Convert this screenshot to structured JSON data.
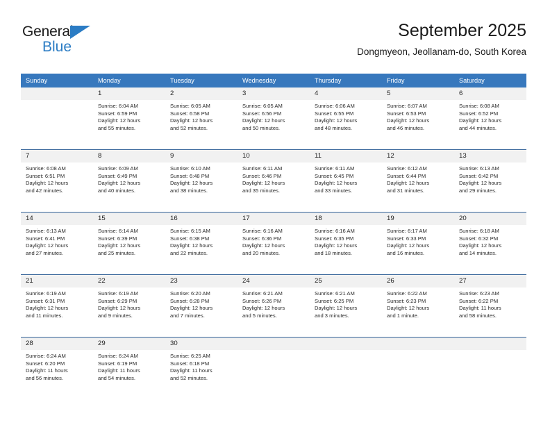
{
  "brand": {
    "name_part1": "General",
    "name_part2": "Blue",
    "triangle_icon": "triangle-icon",
    "accent_color": "#2b7cc4"
  },
  "header": {
    "title": "September 2025",
    "subtitle": "Dongmyeon, Jeollanam-do, South Korea"
  },
  "calendar": {
    "header_color": "#3778bd",
    "daynum_band_color": "#f1f1f1",
    "week_divider_color": "#2f5f96",
    "weekday_headers": [
      "Sunday",
      "Monday",
      "Tuesday",
      "Wednesday",
      "Thursday",
      "Friday",
      "Saturday"
    ],
    "weeks": [
      [
        {
          "day": "",
          "empty": true,
          "sunrise": "",
          "sunset": "",
          "daylight1": "",
          "daylight2": ""
        },
        {
          "day": "1",
          "sunrise": "Sunrise: 6:04 AM",
          "sunset": "Sunset: 6:59 PM",
          "daylight1": "Daylight: 12 hours",
          "daylight2": "and 55 minutes."
        },
        {
          "day": "2",
          "sunrise": "Sunrise: 6:05 AM",
          "sunset": "Sunset: 6:58 PM",
          "daylight1": "Daylight: 12 hours",
          "daylight2": "and 52 minutes."
        },
        {
          "day": "3",
          "sunrise": "Sunrise: 6:05 AM",
          "sunset": "Sunset: 6:56 PM",
          "daylight1": "Daylight: 12 hours",
          "daylight2": "and 50 minutes."
        },
        {
          "day": "4",
          "sunrise": "Sunrise: 6:06 AM",
          "sunset": "Sunset: 6:55 PM",
          "daylight1": "Daylight: 12 hours",
          "daylight2": "and 48 minutes."
        },
        {
          "day": "5",
          "sunrise": "Sunrise: 6:07 AM",
          "sunset": "Sunset: 6:53 PM",
          "daylight1": "Daylight: 12 hours",
          "daylight2": "and 46 minutes."
        },
        {
          "day": "6",
          "sunrise": "Sunrise: 6:08 AM",
          "sunset": "Sunset: 6:52 PM",
          "daylight1": "Daylight: 12 hours",
          "daylight2": "and 44 minutes."
        }
      ],
      [
        {
          "day": "7",
          "sunrise": "Sunrise: 6:08 AM",
          "sunset": "Sunset: 6:51 PM",
          "daylight1": "Daylight: 12 hours",
          "daylight2": "and 42 minutes."
        },
        {
          "day": "8",
          "sunrise": "Sunrise: 6:09 AM",
          "sunset": "Sunset: 6:49 PM",
          "daylight1": "Daylight: 12 hours",
          "daylight2": "and 40 minutes."
        },
        {
          "day": "9",
          "sunrise": "Sunrise: 6:10 AM",
          "sunset": "Sunset: 6:48 PM",
          "daylight1": "Daylight: 12 hours",
          "daylight2": "and 38 minutes."
        },
        {
          "day": "10",
          "sunrise": "Sunrise: 6:11 AM",
          "sunset": "Sunset: 6:46 PM",
          "daylight1": "Daylight: 12 hours",
          "daylight2": "and 35 minutes."
        },
        {
          "day": "11",
          "sunrise": "Sunrise: 6:11 AM",
          "sunset": "Sunset: 6:45 PM",
          "daylight1": "Daylight: 12 hours",
          "daylight2": "and 33 minutes."
        },
        {
          "day": "12",
          "sunrise": "Sunrise: 6:12 AM",
          "sunset": "Sunset: 6:44 PM",
          "daylight1": "Daylight: 12 hours",
          "daylight2": "and 31 minutes."
        },
        {
          "day": "13",
          "sunrise": "Sunrise: 6:13 AM",
          "sunset": "Sunset: 6:42 PM",
          "daylight1": "Daylight: 12 hours",
          "daylight2": "and 29 minutes."
        }
      ],
      [
        {
          "day": "14",
          "sunrise": "Sunrise: 6:13 AM",
          "sunset": "Sunset: 6:41 PM",
          "daylight1": "Daylight: 12 hours",
          "daylight2": "and 27 minutes."
        },
        {
          "day": "15",
          "sunrise": "Sunrise: 6:14 AM",
          "sunset": "Sunset: 6:39 PM",
          "daylight1": "Daylight: 12 hours",
          "daylight2": "and 25 minutes."
        },
        {
          "day": "16",
          "sunrise": "Sunrise: 6:15 AM",
          "sunset": "Sunset: 6:38 PM",
          "daylight1": "Daylight: 12 hours",
          "daylight2": "and 22 minutes."
        },
        {
          "day": "17",
          "sunrise": "Sunrise: 6:16 AM",
          "sunset": "Sunset: 6:36 PM",
          "daylight1": "Daylight: 12 hours",
          "daylight2": "and 20 minutes."
        },
        {
          "day": "18",
          "sunrise": "Sunrise: 6:16 AM",
          "sunset": "Sunset: 6:35 PM",
          "daylight1": "Daylight: 12 hours",
          "daylight2": "and 18 minutes."
        },
        {
          "day": "19",
          "sunrise": "Sunrise: 6:17 AM",
          "sunset": "Sunset: 6:33 PM",
          "daylight1": "Daylight: 12 hours",
          "daylight2": "and 16 minutes."
        },
        {
          "day": "20",
          "sunrise": "Sunrise: 6:18 AM",
          "sunset": "Sunset: 6:32 PM",
          "daylight1": "Daylight: 12 hours",
          "daylight2": "and 14 minutes."
        }
      ],
      [
        {
          "day": "21",
          "sunrise": "Sunrise: 6:19 AM",
          "sunset": "Sunset: 6:31 PM",
          "daylight1": "Daylight: 12 hours",
          "daylight2": "and 11 minutes."
        },
        {
          "day": "22",
          "sunrise": "Sunrise: 6:19 AM",
          "sunset": "Sunset: 6:29 PM",
          "daylight1": "Daylight: 12 hours",
          "daylight2": "and 9 minutes."
        },
        {
          "day": "23",
          "sunrise": "Sunrise: 6:20 AM",
          "sunset": "Sunset: 6:28 PM",
          "daylight1": "Daylight: 12 hours",
          "daylight2": "and 7 minutes."
        },
        {
          "day": "24",
          "sunrise": "Sunrise: 6:21 AM",
          "sunset": "Sunset: 6:26 PM",
          "daylight1": "Daylight: 12 hours",
          "daylight2": "and 5 minutes."
        },
        {
          "day": "25",
          "sunrise": "Sunrise: 6:21 AM",
          "sunset": "Sunset: 6:25 PM",
          "daylight1": "Daylight: 12 hours",
          "daylight2": "and 3 minutes."
        },
        {
          "day": "26",
          "sunrise": "Sunrise: 6:22 AM",
          "sunset": "Sunset: 6:23 PM",
          "daylight1": "Daylight: 12 hours",
          "daylight2": "and 1 minute."
        },
        {
          "day": "27",
          "sunrise": "Sunrise: 6:23 AM",
          "sunset": "Sunset: 6:22 PM",
          "daylight1": "Daylight: 11 hours",
          "daylight2": "and 58 minutes."
        }
      ],
      [
        {
          "day": "28",
          "sunrise": "Sunrise: 6:24 AM",
          "sunset": "Sunset: 6:20 PM",
          "daylight1": "Daylight: 11 hours",
          "daylight2": "and 56 minutes."
        },
        {
          "day": "29",
          "sunrise": "Sunrise: 6:24 AM",
          "sunset": "Sunset: 6:19 PM",
          "daylight1": "Daylight: 11 hours",
          "daylight2": "and 54 minutes."
        },
        {
          "day": "30",
          "sunrise": "Sunrise: 6:25 AM",
          "sunset": "Sunset: 6:18 PM",
          "daylight1": "Daylight: 11 hours",
          "daylight2": "and 52 minutes."
        },
        {
          "day": "",
          "empty": true,
          "sunrise": "",
          "sunset": "",
          "daylight1": "",
          "daylight2": ""
        },
        {
          "day": "",
          "empty": true,
          "sunrise": "",
          "sunset": "",
          "daylight1": "",
          "daylight2": ""
        },
        {
          "day": "",
          "empty": true,
          "sunrise": "",
          "sunset": "",
          "daylight1": "",
          "daylight2": ""
        },
        {
          "day": "",
          "empty": true,
          "sunrise": "",
          "sunset": "",
          "daylight1": "",
          "daylight2": ""
        }
      ]
    ]
  }
}
